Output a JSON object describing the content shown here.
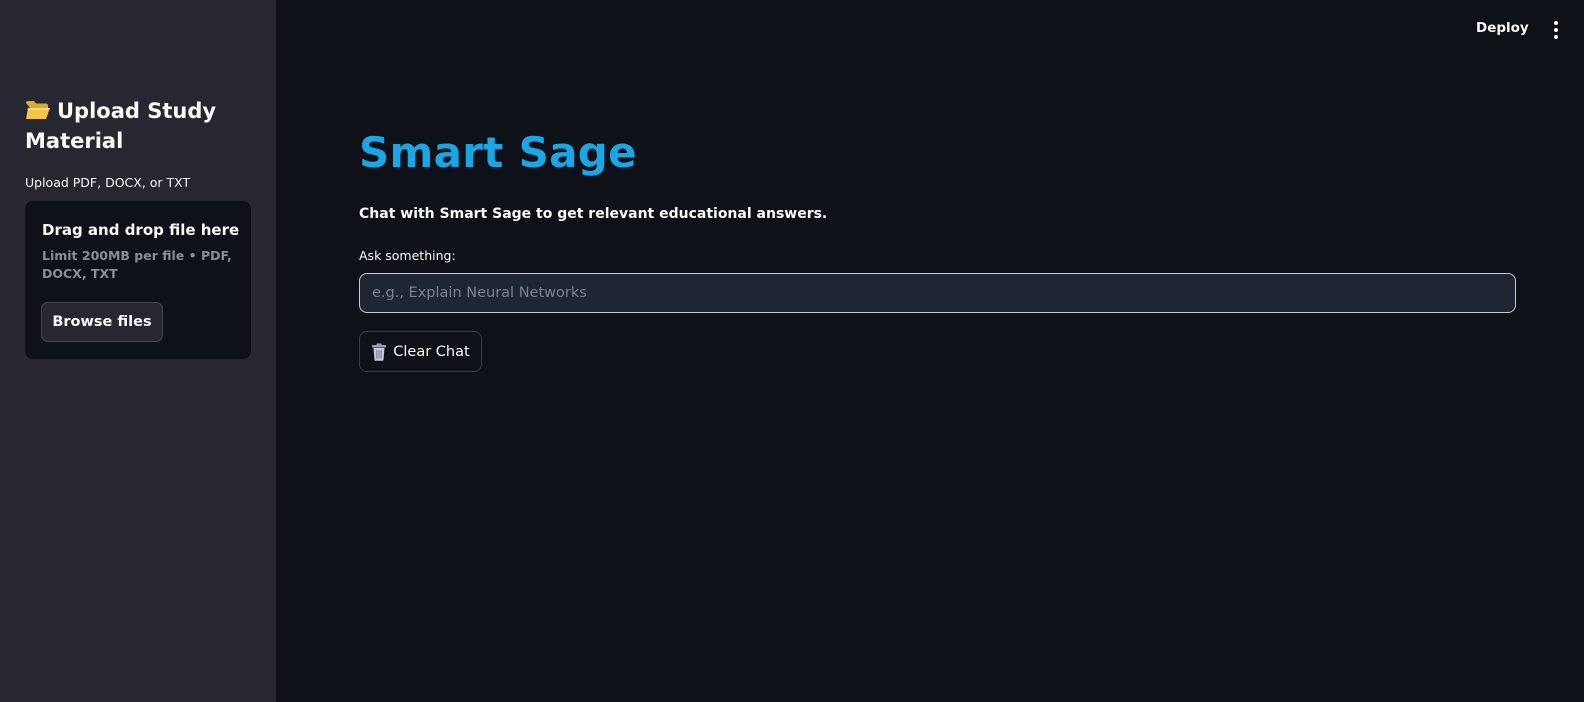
{
  "colors": {
    "background": "#0e1117",
    "sidebar": "#262730",
    "title_accent": "#1aa6e4",
    "input_bg": "#1e2533",
    "muted_text": "#8b8d96"
  },
  "topbar": {
    "deploy_label": "Deploy",
    "menu_icon": "kebab-menu-icon"
  },
  "sidebar": {
    "title_icon": "open-folder-icon",
    "title": "Upload Study Material",
    "upload_label": "Upload PDF, DOCX, or TXT",
    "dropzone": {
      "title": "Drag and drop file here",
      "subtitle": "Limit 200MB per file • PDF, DOCX, TXT",
      "browse_label": "Browse files"
    }
  },
  "main": {
    "title": "Smart Sage",
    "subtitle": "Chat with Smart Sage to get relevant educational answers.",
    "ask_label": "Ask something:",
    "ask_placeholder": "e.g., Explain Neural Networks",
    "ask_value": "",
    "clear_icon": "wastebasket-icon",
    "clear_label": "Clear Chat"
  }
}
